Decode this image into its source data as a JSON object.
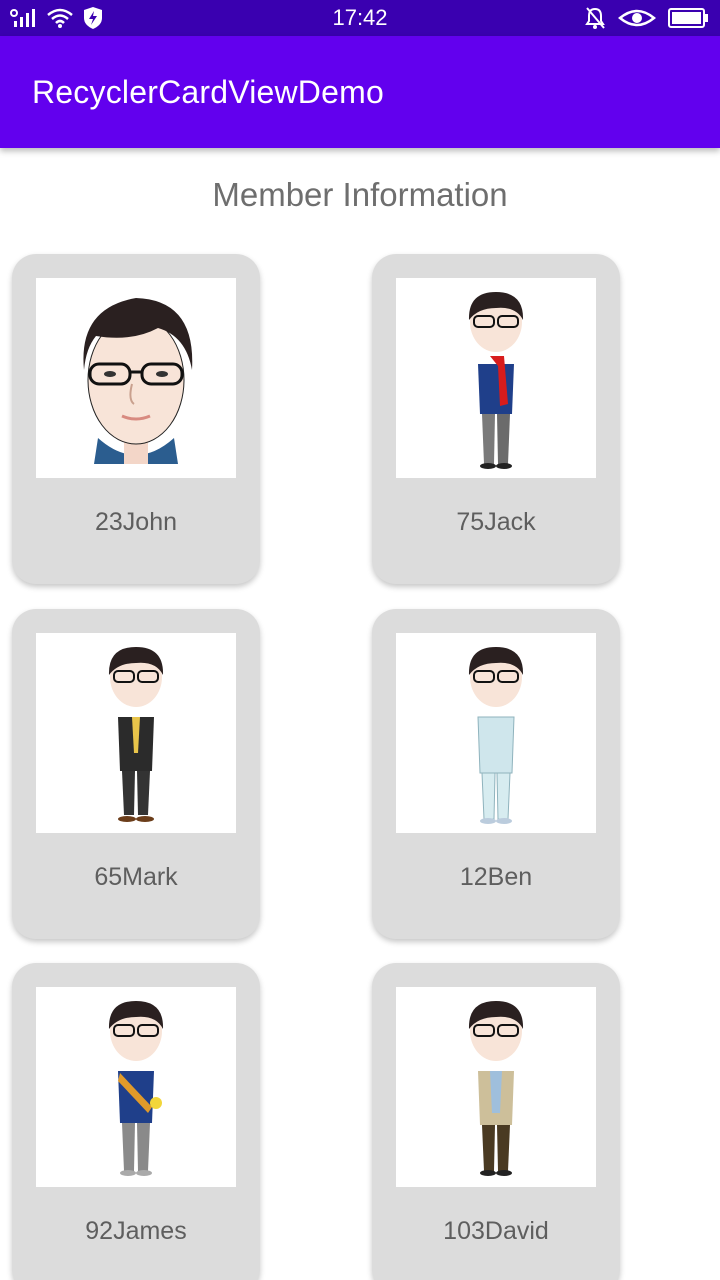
{
  "status_bar": {
    "time": "17:42",
    "icons_left": [
      "signal-icon",
      "wifi-icon",
      "shield-icon"
    ],
    "icons_right": [
      "mute-icon",
      "eye-icon",
      "battery-icon"
    ]
  },
  "app_bar": {
    "title": "RecyclerCardViewDemo"
  },
  "heading": "Member Information",
  "colors": {
    "status_bar": "#3a00b0",
    "app_bar": "#6200ee",
    "card": "#dcdcdc"
  },
  "members": [
    {
      "label": "23John",
      "avatar": "head-portrait"
    },
    {
      "label": "75Jack",
      "avatar": "figure-blue-jacket-red-scarf"
    },
    {
      "label": "65Mark",
      "avatar": "figure-black-suit"
    },
    {
      "label": "12Ben",
      "avatar": "figure-light-blue-suit"
    },
    {
      "label": "92James",
      "avatar": "figure-blue-vest"
    },
    {
      "label": "103David",
      "avatar": "figure-beige-jacket"
    }
  ]
}
